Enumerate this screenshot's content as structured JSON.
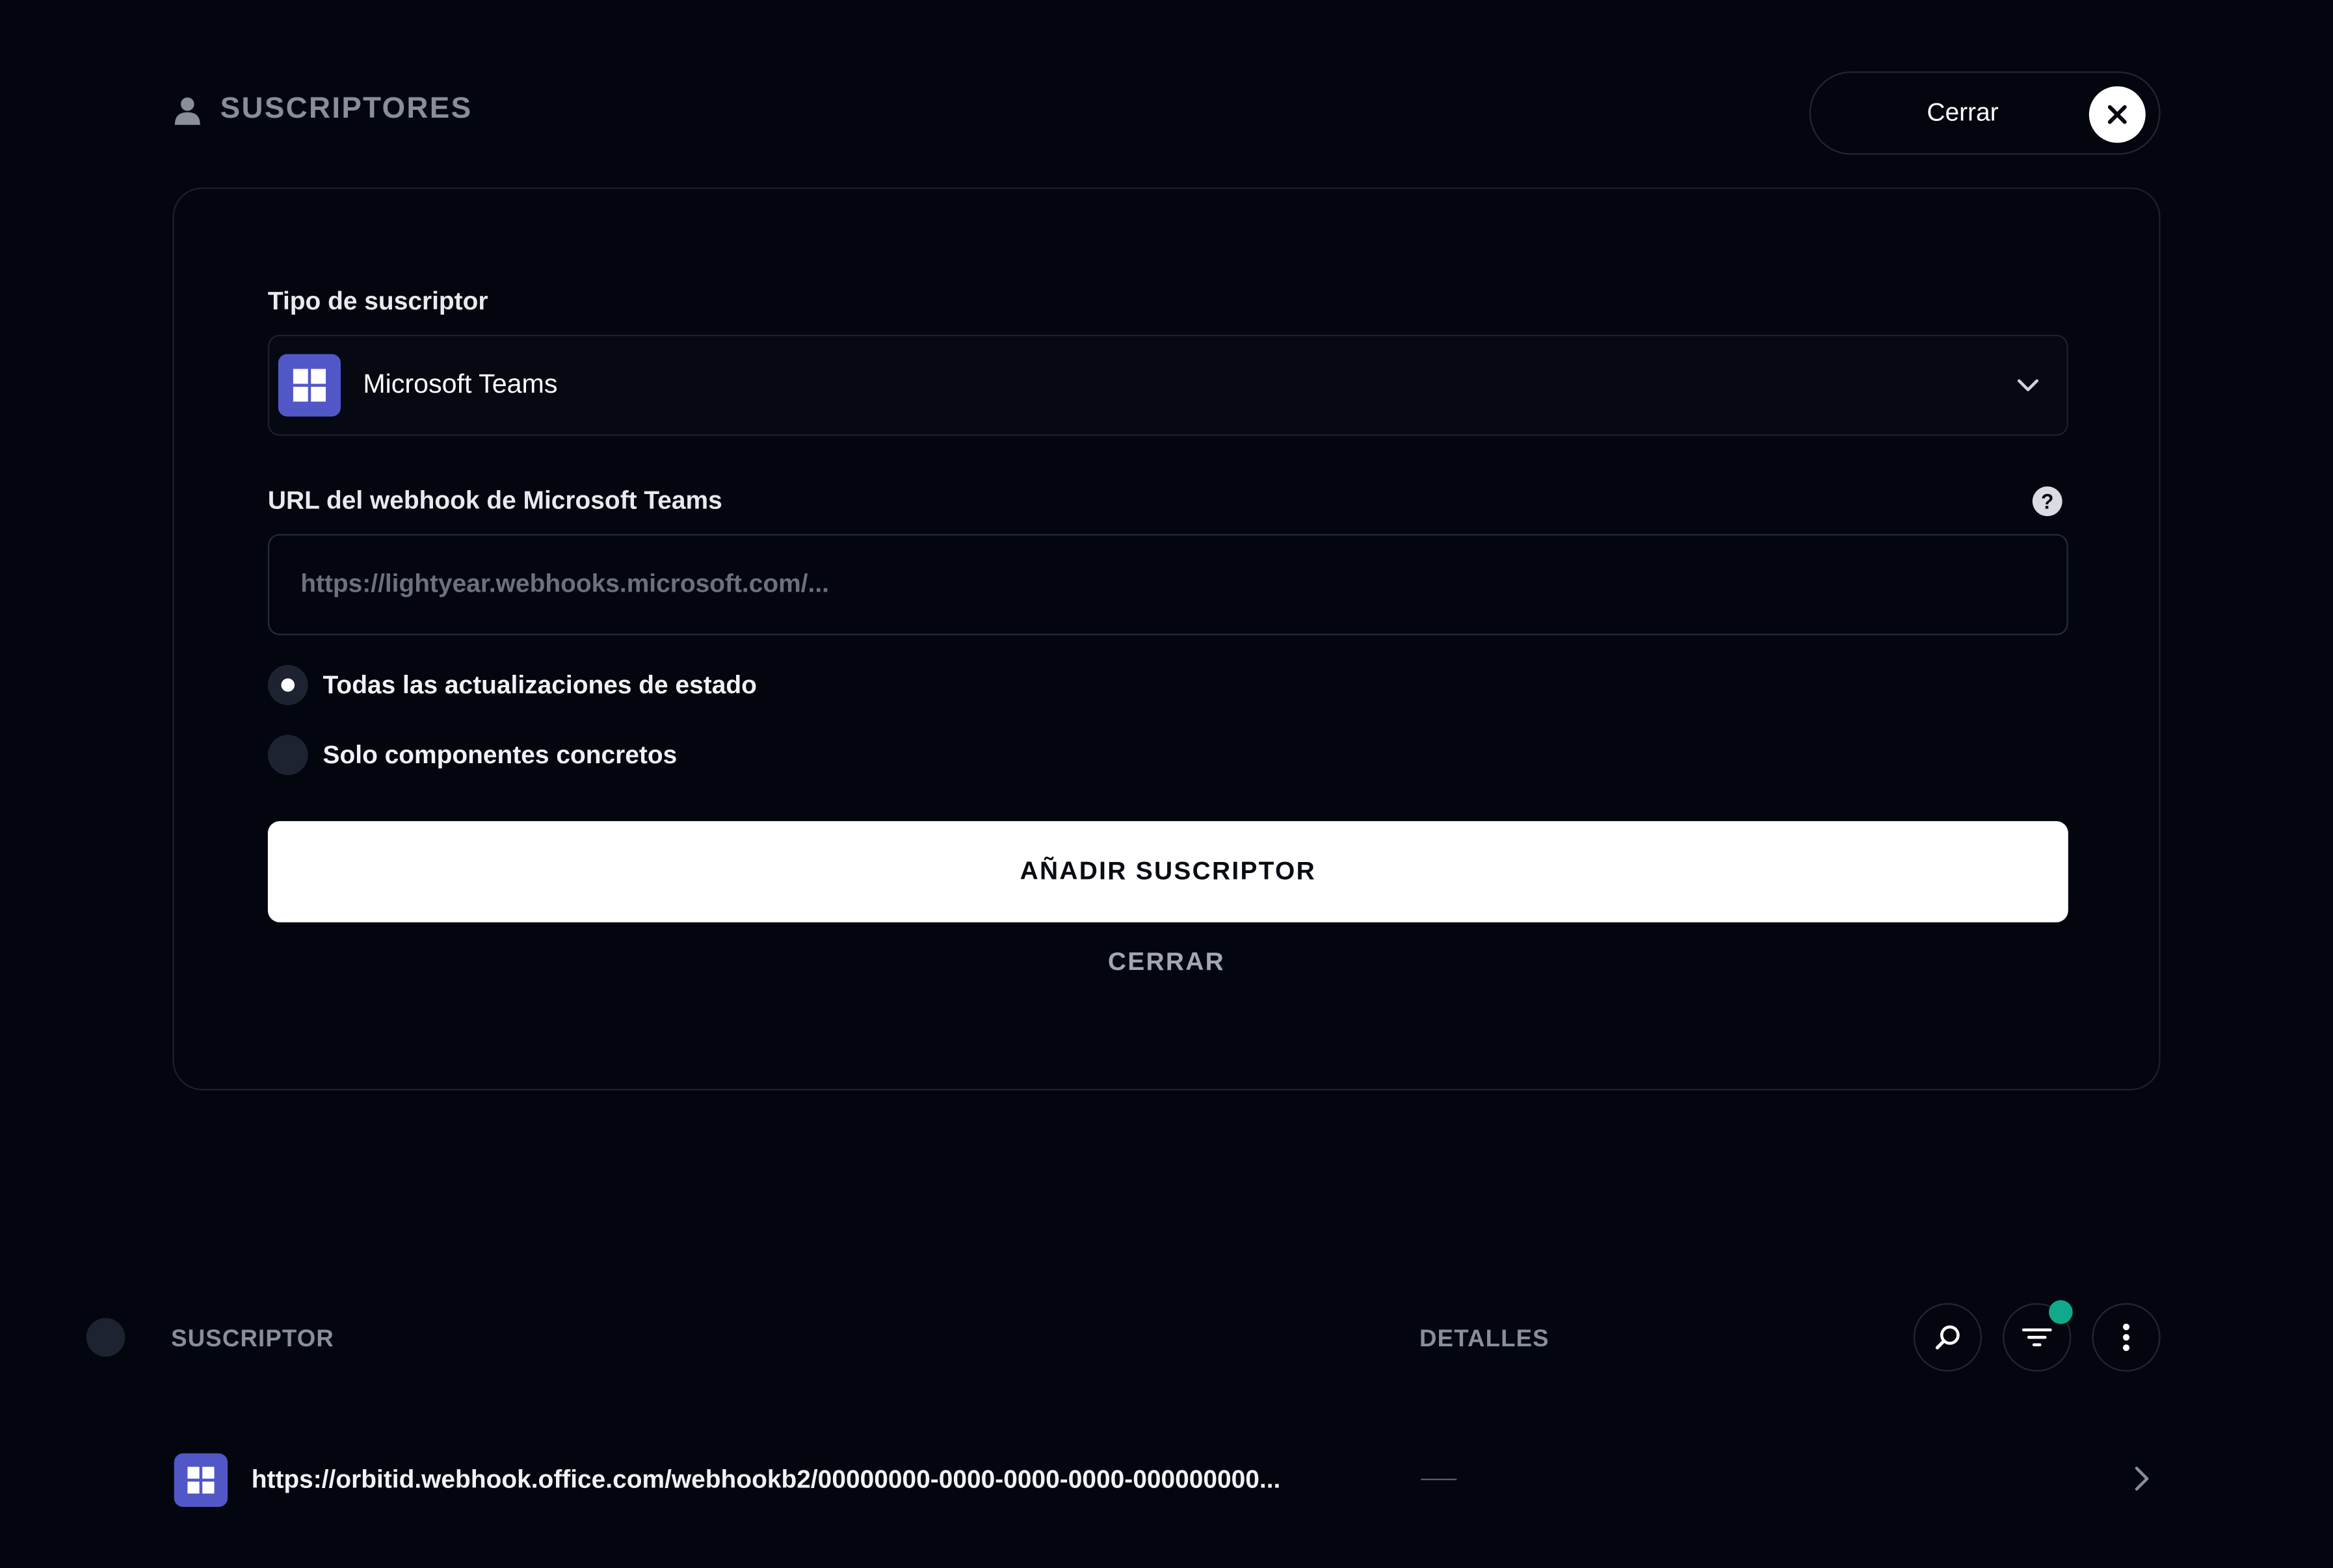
{
  "header": {
    "title": "SUSCRIPTORES",
    "close_label": "Cerrar"
  },
  "form": {
    "type_label": "Tipo de suscriptor",
    "type_value": "Microsoft Teams",
    "url_label": "URL del webhook de Microsoft Teams",
    "help_glyph": "?",
    "url_placeholder": "https://lightyear.webhooks.microsoft.com/...",
    "url_value": "",
    "radio_options": [
      {
        "label": "Todas las actualizaciones de estado",
        "selected": true
      },
      {
        "label": "Solo componentes concretos",
        "selected": false
      }
    ],
    "submit_label": "AÑADIR SUSCRIPTOR",
    "cancel_label": "CERRAR"
  },
  "table": {
    "columns": [
      "SUSCRIPTOR",
      "DETALLES"
    ],
    "rows": [
      {
        "url": "https://orbitid.webhook.office.com/webhookb2/00000000-0000-0000-0000-000000000...",
        "details": ""
      }
    ],
    "filter_active": true
  },
  "icons": {
    "title": "user-icon",
    "close": "close-icon",
    "teams": "microsoft-teams-icon",
    "dropdown": "chevron-down-icon",
    "help": "help-icon",
    "search": "search-icon",
    "filter": "filter-icon",
    "more": "more-vertical-icon",
    "row": "chevron-right-icon"
  },
  "colors": {
    "background": "#04060f",
    "accent_teams": "#5257c7",
    "filter_indicator": "#10a98a",
    "muted_text": "#8a8e98"
  }
}
